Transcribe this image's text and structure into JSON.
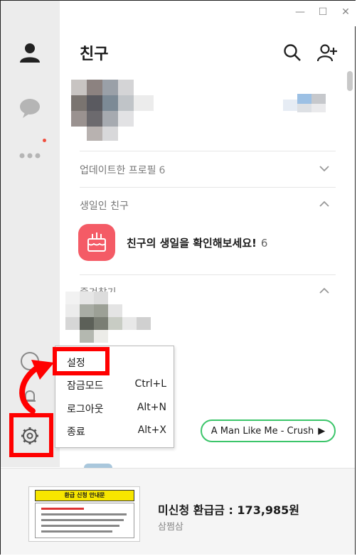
{
  "window": {
    "minimize": "—",
    "maximize": "☐",
    "close": "✕"
  },
  "header": {
    "title": "친구"
  },
  "sections": {
    "updated_profiles": {
      "label": "업데이트한 프로필",
      "count": "6"
    },
    "birthday": {
      "label": "생일인 친구",
      "banner_text": "친구의 생일을 확인해보세요!",
      "banner_count": "6"
    },
    "favorites": {
      "label": "즐겨찾기"
    }
  },
  "menu": {
    "items": [
      {
        "label": "설정",
        "shortcut": ""
      },
      {
        "label": "잠금모드",
        "shortcut": "Ctrl+L"
      },
      {
        "label": "로그아웃",
        "shortcut": "Alt+N"
      },
      {
        "label": "종료",
        "shortcut": "Alt+X"
      }
    ]
  },
  "music": {
    "label": "A Man Like Me - Crush",
    "play": "▶"
  },
  "ad": {
    "thumb_title": "환급 신청 안내문",
    "title": "미신청 환급금 : 173,985원",
    "subtitle": "삼쩜삼"
  },
  "colors": {
    "sidebar": "#ececec",
    "highlight": "#ff0000",
    "birthday": "#f45b66",
    "music_border": "#3cc56a",
    "notification_dot": "#f04e3e"
  },
  "icons": [
    "person-icon",
    "chat-icon",
    "more-icon",
    "gear-icon",
    "search-icon",
    "add-friend-icon",
    "cake-icon",
    "chevron-down-icon",
    "chevron-up-icon"
  ]
}
